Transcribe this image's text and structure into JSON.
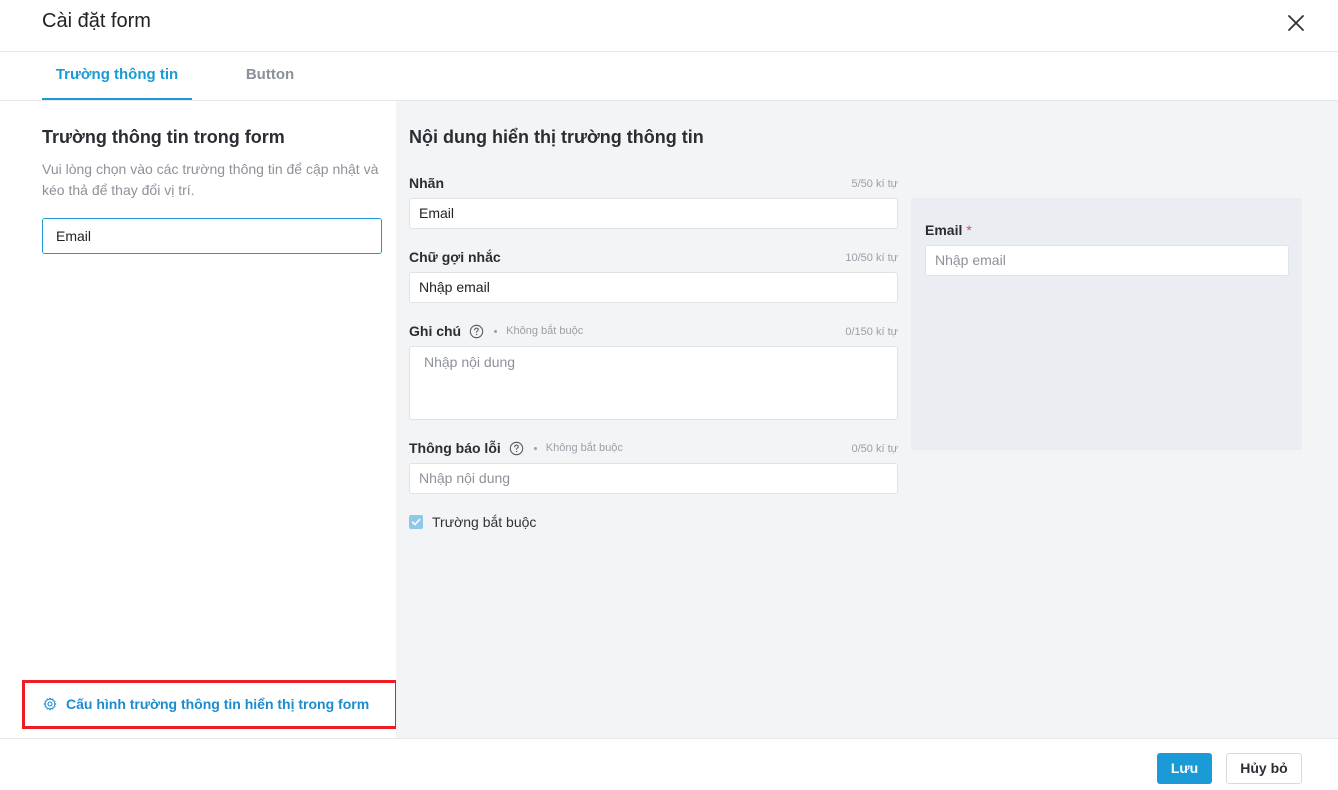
{
  "dialog": {
    "title": "Cài đặt form",
    "close_icon": "close-icon"
  },
  "tabs": [
    {
      "label": "Trường thông tin",
      "active": true
    },
    {
      "label": "Button",
      "active": false
    }
  ],
  "left": {
    "title": "Trường thông tin trong form",
    "description": "Vui lòng chọn vào các trường thông tin để cập nhật và kéo thả để thay đổi vị trí.",
    "fields": [
      "Email"
    ],
    "config_link": {
      "label": "Cấu hình trường thông tin hiển thị trong form",
      "icon": "gear-icon"
    }
  },
  "editor": {
    "title": "Nội dung hiển thị trường thông tin",
    "label_field": {
      "label": "Nhãn",
      "count": "5/50 kí tự",
      "value": "Email"
    },
    "placeholder_field": {
      "label": "Chữ gợi nhắc",
      "count": "10/50 kí tự",
      "value": "Nhập email"
    },
    "note_field": {
      "label": "Ghi chú",
      "optional": "Không bắt buộc",
      "count": "0/150 kí tự",
      "placeholder": "Nhập nội dung"
    },
    "error_field": {
      "label": "Thông báo lỗi",
      "optional": "Không bắt buộc",
      "count": "0/50 kí tự",
      "placeholder": "Nhập nội dung"
    },
    "required_checkbox": {
      "label": "Trường bắt buộc",
      "checked": true
    }
  },
  "preview": {
    "label": "Email",
    "required_mark": "*",
    "placeholder": "Nhập email"
  },
  "footer": {
    "save_label": "Lưu",
    "cancel_label": "Hủy bỏ"
  },
  "colors": {
    "accent": "#1a9ad6",
    "highlight_border": "#ee1c25",
    "required": "#e5484d"
  }
}
